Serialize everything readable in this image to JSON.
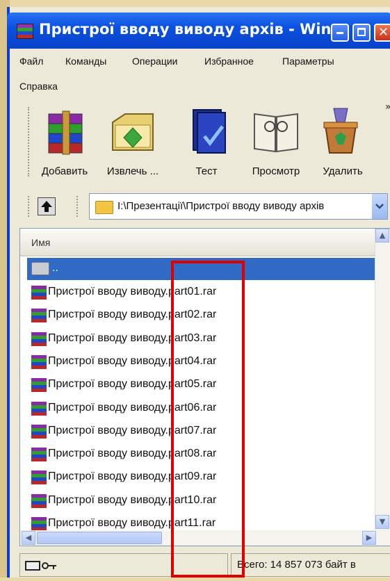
{
  "window": {
    "title": "Пристрої вводу виводу архів - Win...",
    "accent": "#0b51e0"
  },
  "menu": [
    "Файл",
    "Команды",
    "Операции",
    "Избранное",
    "Параметры",
    "Справка"
  ],
  "toolbar": {
    "buttons": [
      {
        "label": "Добавить",
        "icon": "add-archive-icon"
      },
      {
        "label": "Извлечь ...",
        "icon": "extract-icon"
      },
      {
        "label": "Тест",
        "icon": "test-icon"
      },
      {
        "label": "Просмотр",
        "icon": "view-icon"
      },
      {
        "label": "Удалить",
        "icon": "delete-icon"
      }
    ],
    "overflow": "»"
  },
  "address": {
    "path": "I:\\Презентації\\Пристрої вводу виводу архів"
  },
  "list": {
    "column_header": "Имя",
    "parent_row": "..",
    "files": [
      "Пристрої вводу виводу.part01.rar",
      "Пристрої вводу виводу.part02.rar",
      "Пристрої вводу виводу.part03.rar",
      "Пристрої вводу виводу.part04.rar",
      "Пристрої вводу виводу.part05.rar",
      "Пристрої вводу виводу.part06.rar",
      "Пристрої вводу виводу.part07.rar",
      "Пристрої вводу виводу.part08.rar",
      "Пристрої вводу виводу.part09.rar",
      "Пристрої вводу виводу.part10.rar",
      "Пристрої вводу виводу.part11.rar"
    ]
  },
  "status": {
    "total": "Всего: 14 857 073 байт в"
  },
  "highlight_color": "#e10000"
}
